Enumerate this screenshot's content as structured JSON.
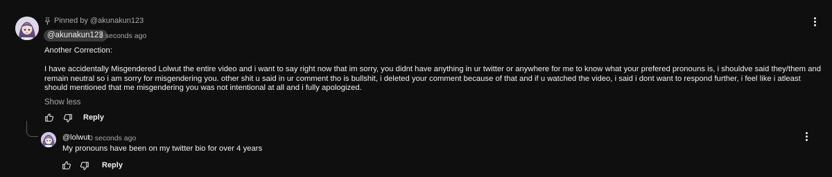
{
  "main_comment": {
    "pinned_label": "Pinned by @akunakun123",
    "author": "@akunakun123",
    "timestamp": "8 seconds ago",
    "paragraph_1": "Another Correction:",
    "paragraph_2": "I have accidentally Misgendered Lolwut the entire video and i want to say right now that im sorry, you didnt have anything in ur twitter or anywhere for me to know what your prefered pronouns is, i shouldve said they/them and remain neutral so i am sorry for misgendering you. other shit u said  in ur comment tho is bullshit, i deleted your comment because of that and if u watched the video, i said i dont want to respond further, i feel like i atleast should mentioned that me misgendering you was not intentional at all and i fully apologized.",
    "show_less_label": "Show less",
    "reply_label": "Reply",
    "icons": [
      "pin-icon",
      "thumbs-up-icon",
      "thumbs-down-icon",
      "more-options-icon"
    ]
  },
  "reply_comment": {
    "author": "@lolwut",
    "timestamp": "0 seconds ago",
    "text": "My pronouns have been on my twitter bio for over 4 years",
    "reply_label": "Reply",
    "icons": [
      "thumbs-up-icon",
      "thumbs-down-icon",
      "more-options-icon"
    ]
  },
  "colors": {
    "background": "#0f0f0f",
    "primary_text": "#f1f1f1",
    "secondary_text": "#aaaaaa",
    "author_chip": "#3a3a3a"
  }
}
